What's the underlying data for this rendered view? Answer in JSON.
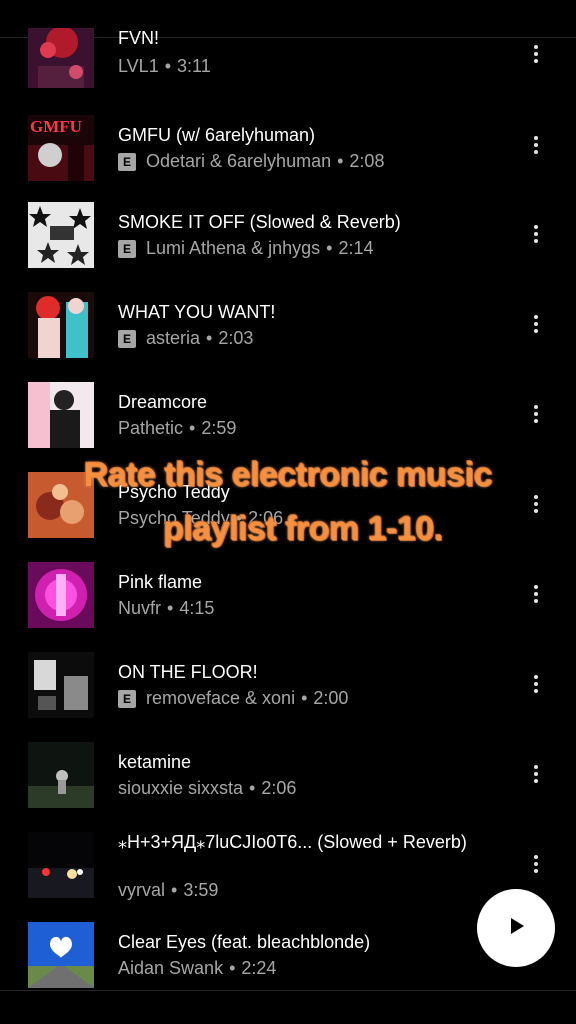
{
  "tracks": [
    {
      "title": "FVN!",
      "artist": "LVL1",
      "duration": "3:11",
      "explicit": false
    },
    {
      "title": "GMFU (w/ 6arelyhuman)",
      "artist": "Odetari & 6arelyhuman",
      "duration": "2:08",
      "explicit": true,
      "thumb_text": "GMFU"
    },
    {
      "title": "SMOKE IT OFF (Slowed & Reverb)",
      "artist": "Lumi Athena & jnhygs",
      "duration": "2:14",
      "explicit": true
    },
    {
      "title": "WHAT YOU WANT!",
      "artist": "asteria",
      "duration": "2:03",
      "explicit": true
    },
    {
      "title": "Dreamcore",
      "artist": "Pathetic",
      "duration": "2:59",
      "explicit": false
    },
    {
      "title": "Psycho Teddy",
      "artist": "Psycho Teddy",
      "duration": "2:06",
      "explicit": false
    },
    {
      "title": "Pink flame",
      "artist": "Nuvfr",
      "duration": "4:15",
      "explicit": false
    },
    {
      "title": "ON THE FLOOR!",
      "artist": "removeface & xoni",
      "duration": "2:00",
      "explicit": true
    },
    {
      "title": "ketamine",
      "artist": "siouxxie sixxsta",
      "duration": "2:06",
      "explicit": false
    },
    {
      "title": "⁎H+3+ЯД⁎7luCJIo0T6... (Slowed + Reverb)",
      "artist": "vyrval",
      "duration": "3:59",
      "explicit": false
    },
    {
      "title": "Clear Eyes (feat. bleachblonde)",
      "artist": "Aidan Swank",
      "duration": "2:24",
      "explicit": false
    }
  ],
  "badges": {
    "explicit": "E"
  },
  "separator": "•",
  "overlay": {
    "line1": "Rate this electronic music",
    "line2": "playlist from 1-10."
  },
  "icons": {
    "more": "more-vert-icon",
    "play": "play-icon"
  },
  "colors": {
    "background": "#000000",
    "meta": "#a6a6a6",
    "overlay": "#f7903e"
  }
}
